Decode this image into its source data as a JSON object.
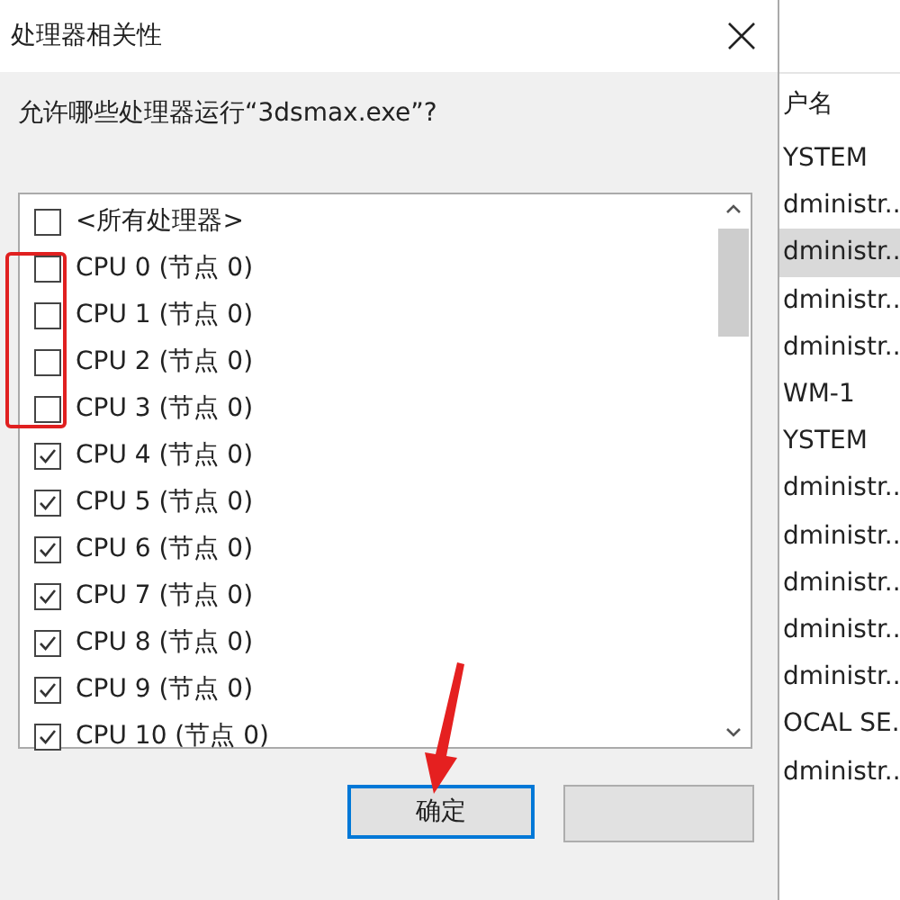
{
  "dialog": {
    "title": "处理器相关性",
    "prompt": "允许哪些处理器运行“3dsmax.exe”?",
    "processors": [
      {
        "label": "<所有处理器>",
        "checked": false
      },
      {
        "label": "CPU 0 (节点 0)",
        "checked": false
      },
      {
        "label": "CPU 1 (节点 0)",
        "checked": false
      },
      {
        "label": "CPU 2 (节点 0)",
        "checked": false
      },
      {
        "label": "CPU 3 (节点 0)",
        "checked": false
      },
      {
        "label": "CPU 4 (节点 0)",
        "checked": true
      },
      {
        "label": "CPU 5 (节点 0)",
        "checked": true
      },
      {
        "label": "CPU 6 (节点 0)",
        "checked": true
      },
      {
        "label": "CPU 7 (节点 0)",
        "checked": true
      },
      {
        "label": "CPU 8 (节点 0)",
        "checked": true
      },
      {
        "label": "CPU 9 (节点 0)",
        "checked": true
      },
      {
        "label": "CPU 10 (节点 0)",
        "checked": true
      }
    ],
    "ok_button": "确定"
  },
  "background_table": {
    "column_header": "户名",
    "rows": [
      {
        "text": "YSTEM",
        "selected": false
      },
      {
        "text": "dministr..",
        "selected": false
      },
      {
        "text": "dministr..",
        "selected": true
      },
      {
        "text": "dministr..",
        "selected": false
      },
      {
        "text": "dministr..",
        "selected": false
      },
      {
        "text": "WM-1",
        "selected": false
      },
      {
        "text": "YSTEM",
        "selected": false
      },
      {
        "text": "dministr..",
        "selected": false
      },
      {
        "text": "dministr..",
        "selected": false
      },
      {
        "text": "dministr..",
        "selected": false
      },
      {
        "text": "dministr..",
        "selected": false
      },
      {
        "text": "dministr..",
        "selected": false
      },
      {
        "text": "OCAL SE..",
        "selected": false
      },
      {
        "text": "dministr..",
        "selected": false
      }
    ]
  }
}
